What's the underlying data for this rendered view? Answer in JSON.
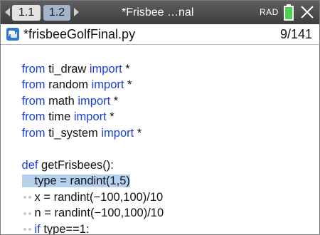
{
  "titlebar": {
    "tabs": [
      {
        "label": "1.1"
      },
      {
        "label": "1.2"
      }
    ],
    "doc_title": "*Frisbee …nal",
    "mode": "RAD"
  },
  "file": {
    "name": "*frisbeeGolfFinal.py",
    "line_info": "9/141"
  },
  "code": {
    "l1": {
      "kw1": "from",
      "mod": " ti_draw ",
      "kw2": "import",
      "star": " *"
    },
    "l2": {
      "kw1": "from",
      "mod": " random ",
      "kw2": "import",
      "star": " *"
    },
    "l3": {
      "kw1": "from",
      "mod": " math ",
      "kw2": "import",
      "star": " *"
    },
    "l4": {
      "kw1": "from",
      "mod": " time ",
      "kw2": "import",
      "star": " *"
    },
    "l5": {
      "kw1": "from",
      "mod": " ti_system ",
      "kw2": "import",
      "star": " *"
    },
    "l7": {
      "kw": "def",
      "rest": " getFrisbees():"
    },
    "l8": {
      "text": "type = randint(1,5)"
    },
    "l9": {
      "text": "x = randint(−100,100)/10"
    },
    "l10": {
      "text": "n = randint(−100,100)/10"
    },
    "l11": {
      "kw": "if",
      "rest": " type==1:"
    }
  },
  "colors": {
    "keyword": "#1b3fd6",
    "selection": "#b4d2ef",
    "battery": "#4cd24c"
  }
}
